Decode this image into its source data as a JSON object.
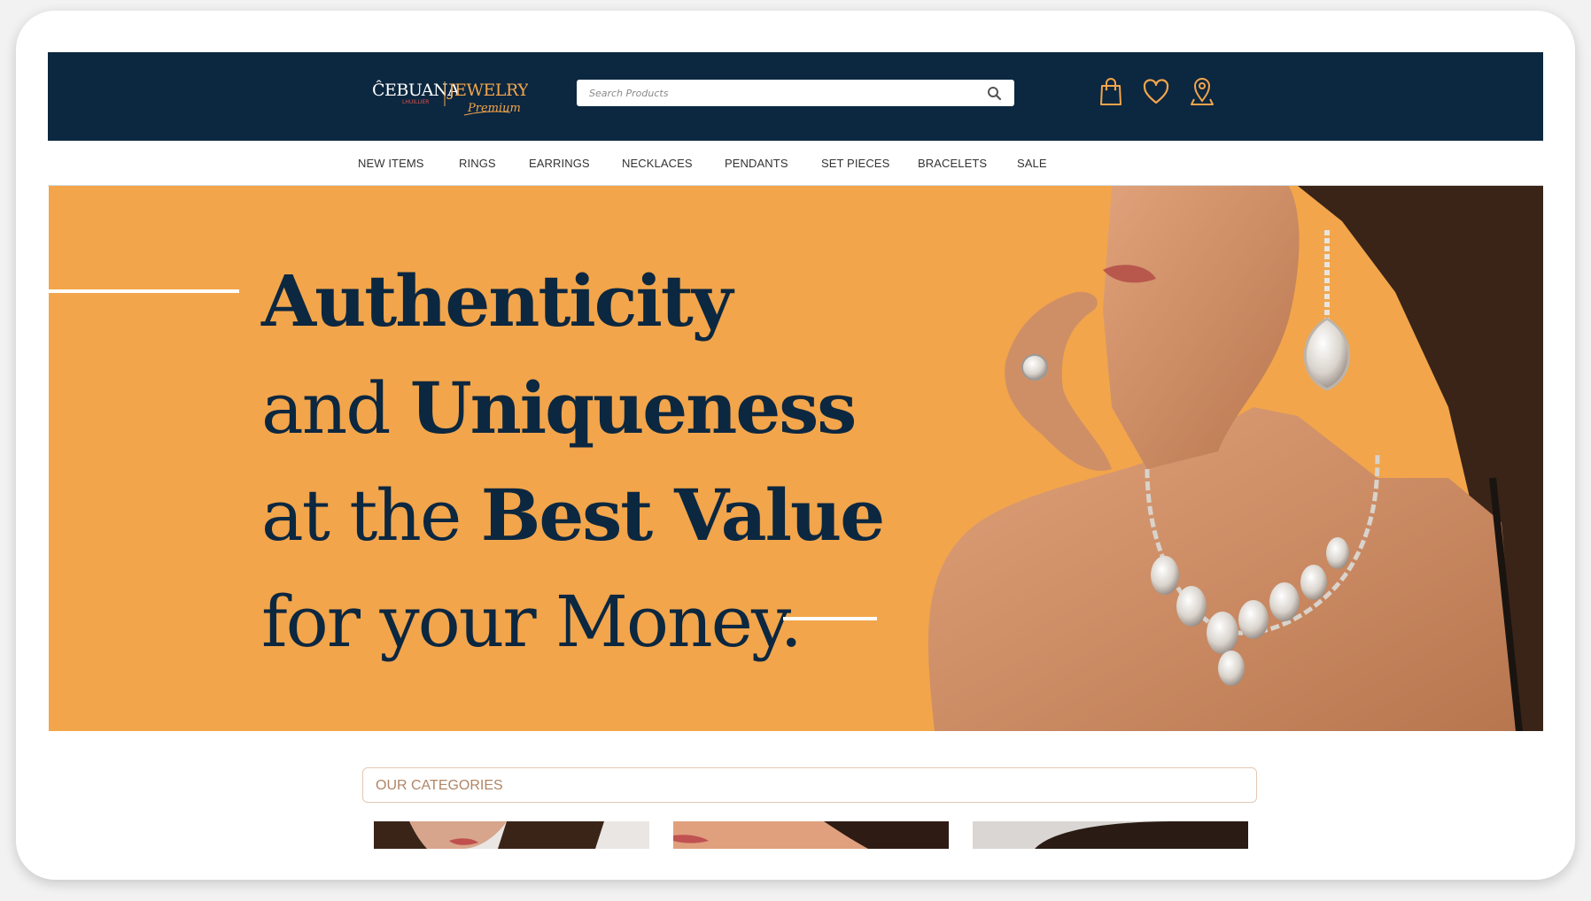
{
  "header": {
    "logo_text": "CEBUANA LHUILLIER JEWELRY Premium",
    "search": {
      "placeholder": "Search Products",
      "value": ""
    },
    "icons": [
      "shopping-bag-icon",
      "heart-icon",
      "location-pin-icon"
    ]
  },
  "nav": {
    "items": [
      {
        "label": "NEW ITEMS"
      },
      {
        "label": "RINGS"
      },
      {
        "label": "EARRINGS"
      },
      {
        "label": "NECKLACES"
      },
      {
        "label": "PENDANTS"
      },
      {
        "label": "SET PIECES"
      },
      {
        "label": "BRACELETS"
      },
      {
        "label": "SALE"
      }
    ]
  },
  "hero": {
    "line1": "Authenticity",
    "line2_a": "and ",
    "line2_b": "Uniqueness",
    "line3_a": "at the ",
    "line3_b": "Best Value",
    "line4": "for your Money."
  },
  "categories": {
    "title": "OUR CATEGORIES"
  },
  "colors": {
    "header_bg": "#0c2740",
    "accent_gold": "#f2a54b",
    "hero_bg": "#f2a54b",
    "category_text": "#b08566"
  }
}
